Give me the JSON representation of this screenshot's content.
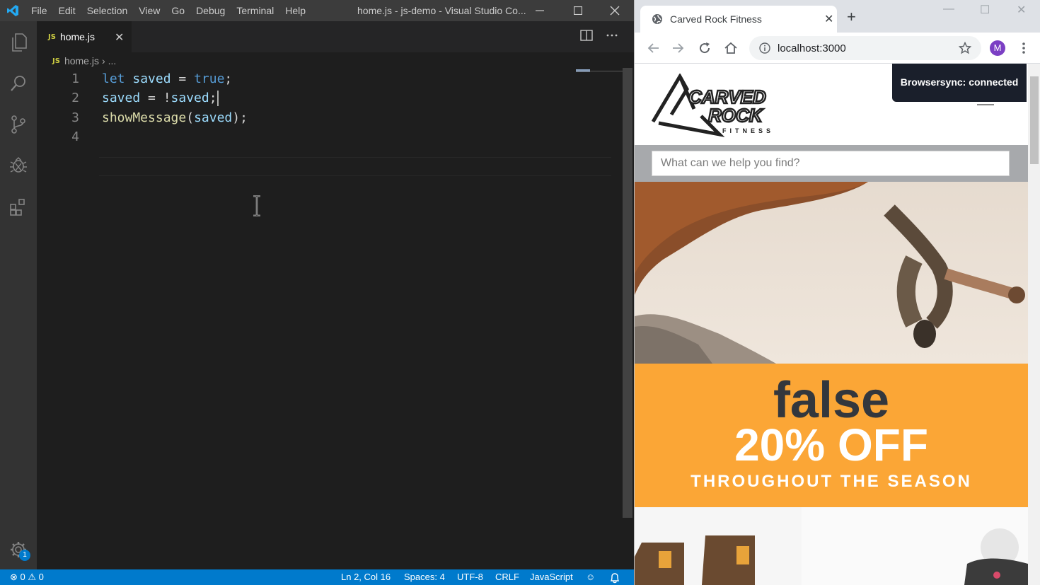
{
  "vscode": {
    "menu": [
      "File",
      "Edit",
      "Selection",
      "View",
      "Go",
      "Debug",
      "Terminal",
      "Help"
    ],
    "window_title": "home.js - js-demo - Visual Studio Co...",
    "tab": {
      "badge": "JS",
      "label": "home.js"
    },
    "breadcrumb": {
      "badge": "JS",
      "file": "home.js",
      "sep": "›",
      "rest": "..."
    },
    "editor": {
      "line_numbers": [
        "1",
        "2",
        "3",
        "4"
      ],
      "lines": {
        "l1": {
          "kw": "let",
          "var": "saved",
          "op": " = ",
          "val": "true",
          "end": ";"
        },
        "l2": {
          "var": "saved",
          "op": " = !",
          "var2": "saved",
          "end": ";"
        },
        "l3": {
          "fn": "showMessage",
          "open": "(",
          "var": "saved",
          "close": ");"
        }
      }
    },
    "activity_badge": "1",
    "status": {
      "errors": "0",
      "warnings": "0",
      "position": "Ln 2, Col 16",
      "spaces": "Spaces: 4",
      "encoding": "UTF-8",
      "eol": "CRLF",
      "language": "JavaScript"
    }
  },
  "browser": {
    "tab_title": "Carved Rock Fitness",
    "url": "localhost:3000",
    "avatar_letter": "M",
    "toast": "Browsersync: connected",
    "logo": {
      "line1": "CARVED",
      "line2": "ROCK",
      "line3": "FITNESS"
    },
    "search_placeholder": "What can we help you find?",
    "promo": {
      "message": "false",
      "headline": "20% OFF",
      "subline": "THROUGHOUT THE SEASON"
    }
  },
  "colors": {
    "vscode_status": "#007acc",
    "promo_orange": "#fba636",
    "keyword": "#569cd6",
    "variable": "#9cdcfe",
    "function": "#dcdcaa"
  }
}
